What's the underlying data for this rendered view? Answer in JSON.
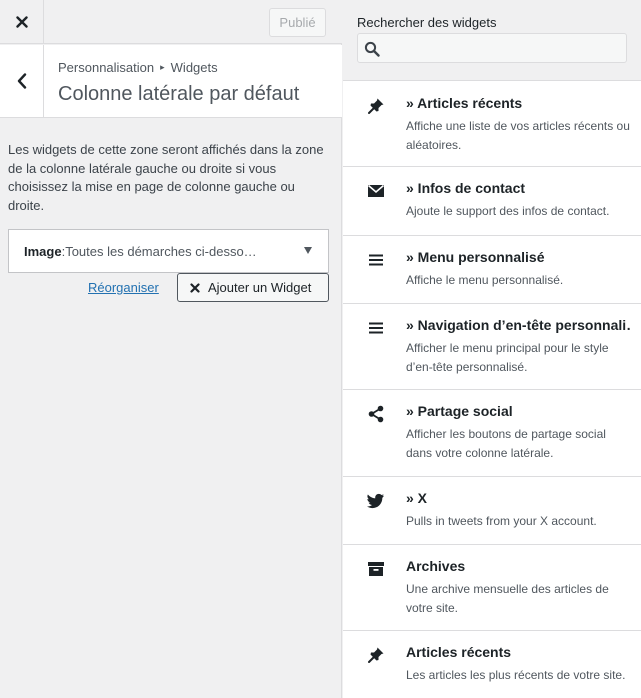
{
  "header": {
    "close_icon": "close-icon",
    "publish_label": "Publié"
  },
  "section": {
    "back_icon": "chevron-left-icon",
    "breadcrumb_parent": "Personnalisation",
    "breadcrumb_sep": "▸",
    "breadcrumb_child": "Widgets",
    "title": "Colonne latérale par défaut"
  },
  "description": "Les widgets de cette zone seront affichés dans la zone de la colonne latérale gauche ou droite si vous choisissez la mise en page de colonne gauche ou droite.",
  "widget": {
    "title": "Image",
    "separator": ": ",
    "subtitle": "Toutes les démarches ci-desso…"
  },
  "actions": {
    "reorder_label": "Réorganiser",
    "add_widget_label": "Ajouter un Widget"
  },
  "search": {
    "label": "Rechercher des widgets",
    "placeholder": "",
    "value": ""
  },
  "available_widgets": [
    {
      "icon": "pin-icon",
      "title": "» Articles récents",
      "desc": "Affiche une liste de vos articles récents ou aléatoires."
    },
    {
      "icon": "envelope-icon",
      "title": "» Infos de contact",
      "desc": "Ajoute le support des infos de contact."
    },
    {
      "icon": "menu-icon",
      "title": "» Menu personnalisé",
      "desc": "Affiche le menu personnalisé."
    },
    {
      "icon": "menu-icon",
      "title": "» Navigation d’en-tête personnali…",
      "desc": "Afficher le menu principal pour le style d’en-tête personnalisé."
    },
    {
      "icon": "share-icon",
      "title": "» Partage social",
      "desc": "Afficher les boutons de partage social dans votre colonne latérale."
    },
    {
      "icon": "twitter-icon",
      "title": "» X",
      "desc": "Pulls in tweets from your X account."
    },
    {
      "icon": "archive-icon",
      "title": "Archives",
      "desc": "Une archive mensuelle des articles de votre site."
    },
    {
      "icon": "pin-icon",
      "title": "Articles récents",
      "desc": "Les articles les plus récents de votre site."
    }
  ]
}
